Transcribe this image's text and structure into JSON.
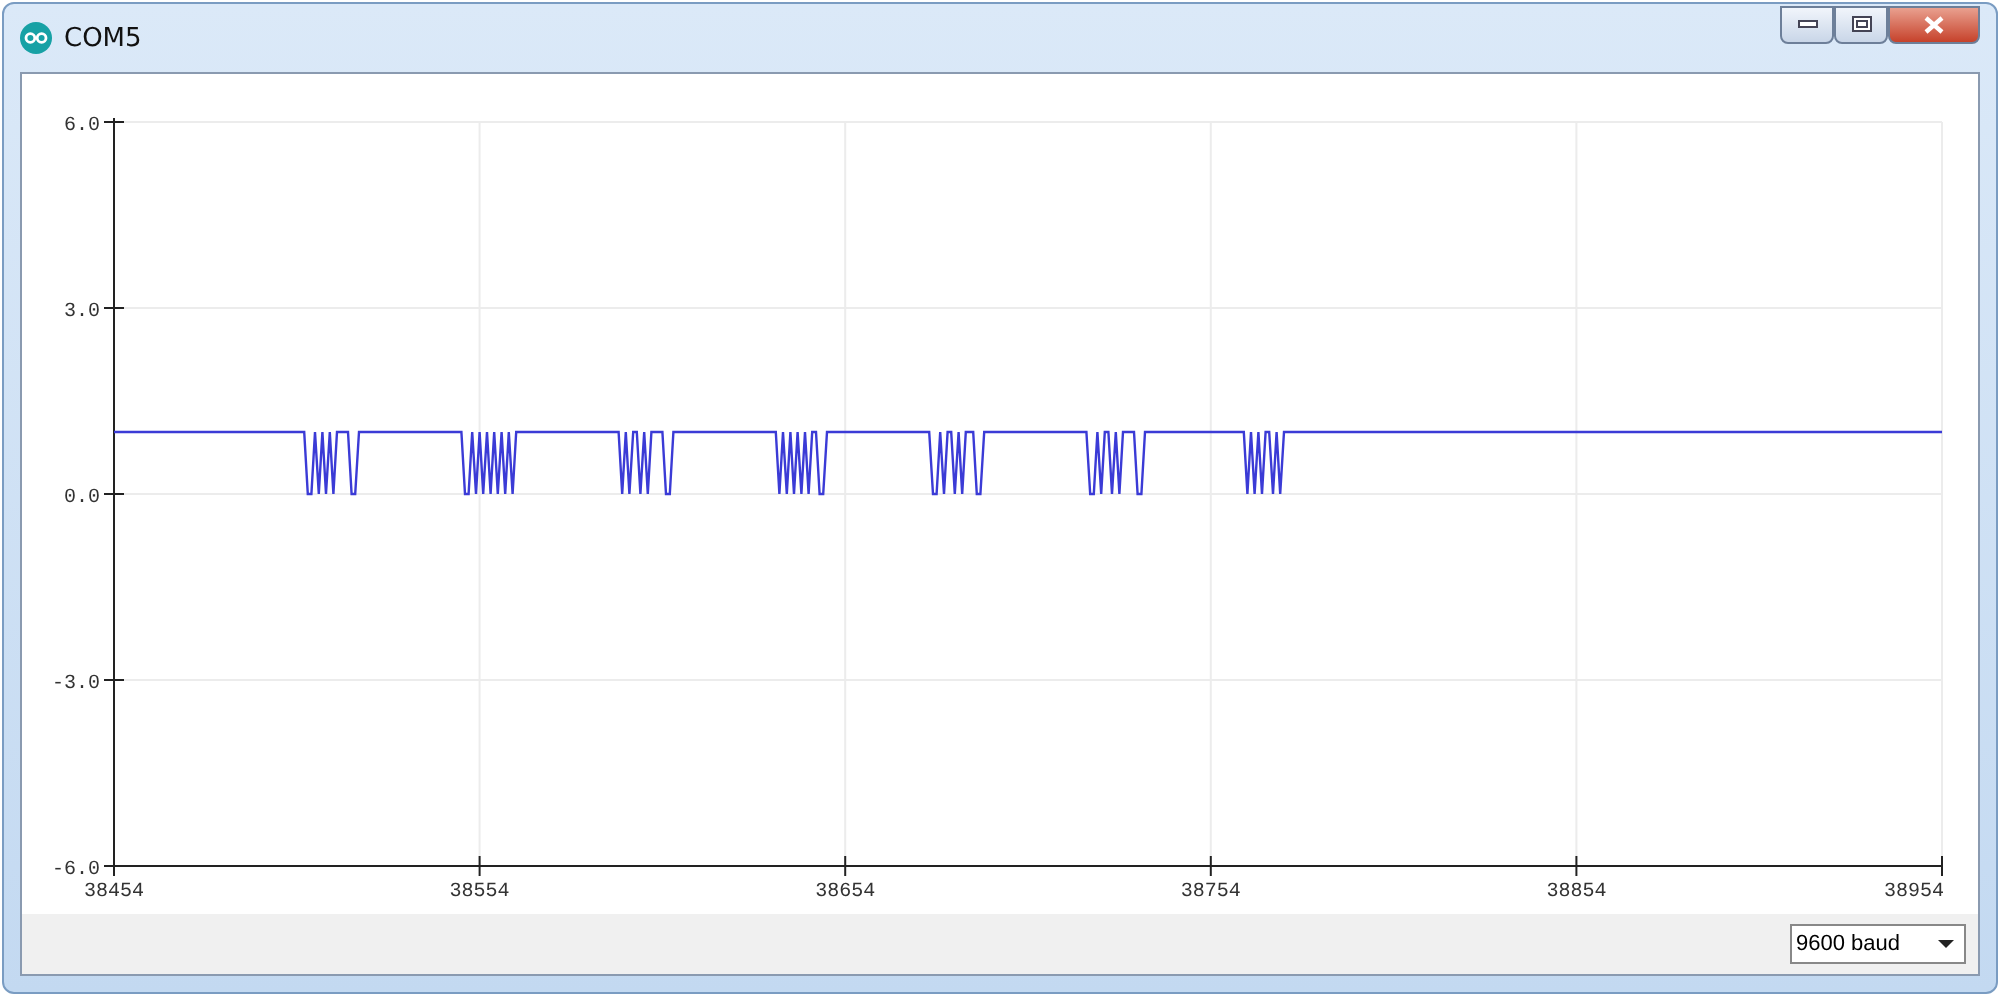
{
  "window": {
    "title": "COM5"
  },
  "plot": {
    "chart_data": {
      "type": "line",
      "xlim": [
        38454,
        38954
      ],
      "ylim": [
        -6,
        6
      ],
      "xticks": [
        38454,
        38554,
        38654,
        38754,
        38854,
        38954
      ],
      "yticks": [
        {
          "value": -6,
          "label": "-6.0"
        },
        {
          "value": -3,
          "label": "-3.0"
        },
        {
          "value": 0,
          "label": "0.0"
        },
        {
          "value": 3,
          "label": "3.0"
        },
        {
          "value": 6,
          "label": "6.0"
        }
      ],
      "x": [
        38454,
        38506,
        38507,
        38508,
        38509,
        38510,
        38511,
        38512,
        38513,
        38514,
        38515,
        38516,
        38517,
        38518,
        38519,
        38520,
        38521,
        38522,
        38549,
        38550,
        38551,
        38552,
        38553,
        38554,
        38555,
        38556,
        38557,
        38558,
        38559,
        38560,
        38561,
        38562,
        38563,
        38564,
        38565,
        38592,
        38593,
        38594,
        38595,
        38596,
        38597,
        38598,
        38599,
        38600,
        38601,
        38602,
        38603,
        38604,
        38605,
        38606,
        38607,
        38608,
        38635,
        38636,
        38637,
        38638,
        38639,
        38640,
        38641,
        38642,
        38643,
        38644,
        38645,
        38646,
        38647,
        38648,
        38649,
        38650,
        38651,
        38677,
        38678,
        38679,
        38680,
        38681,
        38682,
        38683,
        38684,
        38685,
        38686,
        38687,
        38688,
        38689,
        38690,
        38691,
        38692,
        38693,
        38720,
        38721,
        38722,
        38723,
        38724,
        38725,
        38726,
        38727,
        38728,
        38729,
        38730,
        38731,
        38732,
        38733,
        38734,
        38735,
        38736,
        38763,
        38764,
        38765,
        38766,
        38767,
        38768,
        38769,
        38770,
        38771,
        38772,
        38773,
        38774,
        38954
      ],
      "grid": true,
      "series": [
        {
          "color": "#3b3bd6",
          "values": [
            1,
            1,
            0,
            0,
            1,
            0,
            1,
            0,
            1,
            0,
            1,
            1,
            1,
            1,
            0,
            0,
            1,
            1,
            1,
            0,
            0,
            1,
            0,
            1,
            0,
            1,
            0,
            1,
            0,
            1,
            0,
            1,
            0,
            1,
            1,
            1,
            0,
            1,
            0,
            1,
            1,
            0,
            1,
            0,
            1,
            1,
            1,
            1,
            0,
            0,
            1,
            1,
            1,
            0,
            1,
            0,
            1,
            0,
            1,
            0,
            1,
            0,
            1,
            1,
            0,
            0,
            1,
            1,
            1,
            1,
            0,
            0,
            1,
            0,
            1,
            1,
            0,
            1,
            0,
            1,
            1,
            1,
            0,
            0,
            1,
            1,
            1,
            0,
            0,
            1,
            0,
            1,
            1,
            0,
            1,
            0,
            1,
            1,
            1,
            1,
            0,
            0,
            1,
            1,
            0,
            1,
            0,
            1,
            0,
            1,
            1,
            0,
            1,
            0,
            1,
            1
          ]
        }
      ]
    }
  },
  "status_bar": {
    "baud_rate": "9600 baud"
  }
}
